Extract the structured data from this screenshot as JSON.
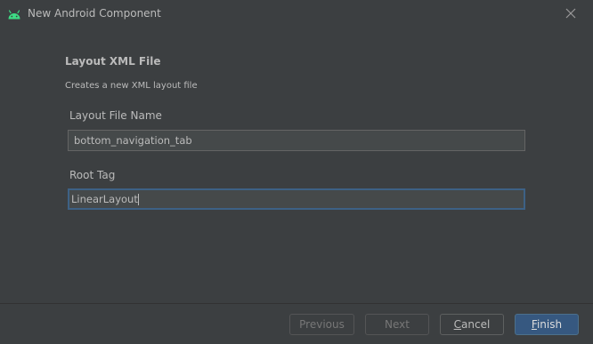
{
  "window": {
    "title": "New Android Component"
  },
  "icons": {
    "app": "android-icon",
    "close": "close-icon"
  },
  "form": {
    "heading": "Layout XML File",
    "description": "Creates a new XML layout file",
    "layout_file_name": {
      "label": "Layout File Name",
      "value": "bottom_navigation_tab"
    },
    "root_tag": {
      "label": "Root Tag",
      "value": "LinearLayout"
    }
  },
  "buttons": {
    "previous": "Previous",
    "next": "Next",
    "cancel_mnemonic": "C",
    "cancel_rest": "ancel",
    "finish_mnemonic": "F",
    "finish_rest": "inish"
  },
  "colors": {
    "background": "#3c3f41",
    "input_background": "#45494a",
    "focus_border": "#3d6185",
    "default_button": "#365880",
    "android_green": "#3ddc84"
  }
}
